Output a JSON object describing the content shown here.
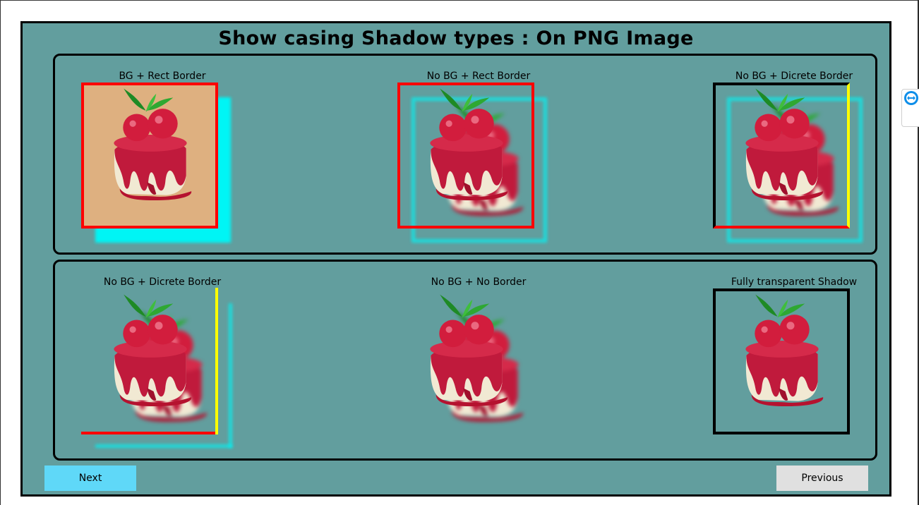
{
  "title": "Show casing Shadow types : On PNG Image",
  "colors": {
    "frame_bg": "#629e9e",
    "shadow": "#00f5f5",
    "border_red": "#ff0000",
    "border_yellow": "#ffff00",
    "border_black": "#000000",
    "image_bg": "#deb080",
    "next_button": "#5fd8f8",
    "previous_button": "#e0e0e0"
  },
  "row1": {
    "cell1": {
      "label": "BG + Rect Border"
    },
    "cell2": {
      "label": "No BG + Rect Border"
    },
    "cell3": {
      "label": "No BG + Dicrete Border"
    }
  },
  "row2": {
    "cell1": {
      "label": "No BG + Dicrete Border"
    },
    "cell2": {
      "label": "No BG + No Border"
    },
    "cell3": {
      "label": "Fully transparent Shadow"
    }
  },
  "buttons": {
    "next": "Next",
    "previous": "Previous"
  },
  "icons": {
    "image": "cake-icon",
    "side_widget": "teamviewer-icon"
  }
}
